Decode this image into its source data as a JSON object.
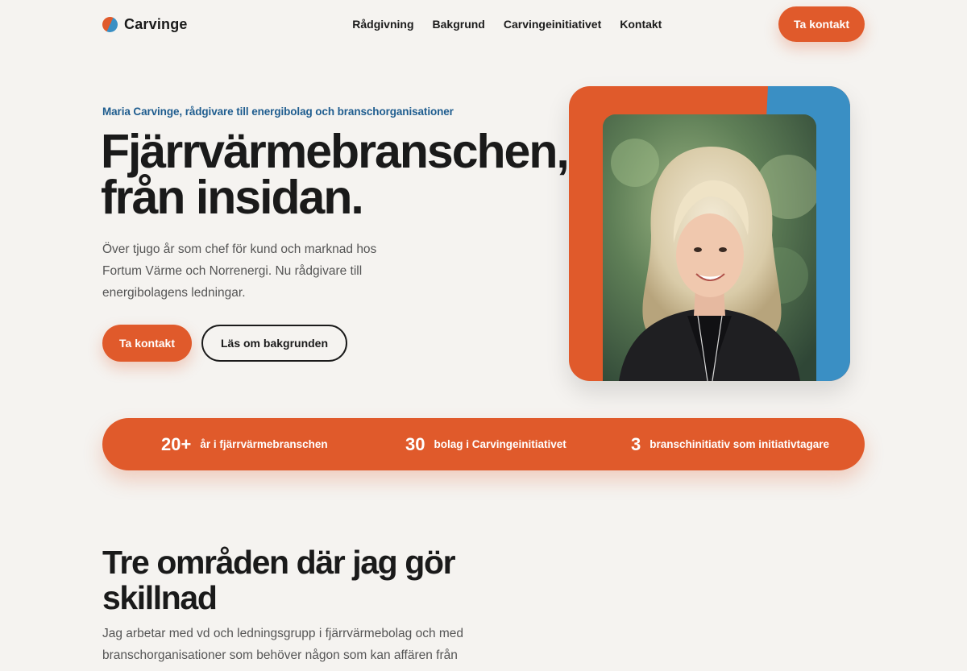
{
  "nav": {
    "brand": "Carvinge",
    "links": [
      "Rådgivning",
      "Bakgrund",
      "Carvingeinitiativet",
      "Kontakt"
    ],
    "cta": "Ta kontakt"
  },
  "hero": {
    "eyebrow": "Maria Carvinge, rådgivare till energibolag och branschorganisationer",
    "title_line1": "Fjärrvärmebranschen,",
    "title_line2": "från insidan.",
    "text": "Över tjugo år som chef för kund och marknad hos Fortum Värme och Norrenergi. Nu rådgivare till energibolagens ledningar.",
    "primary_button": "Ta kontakt",
    "secondary_button": "Läs om bakgrunden"
  },
  "stats": [
    {
      "number": "20+",
      "label": "år i fjärrvärmebranschen"
    },
    {
      "number": "30",
      "label": "bolag i Carvingeinitiativet"
    },
    {
      "number": "3",
      "label": "branschinitiativ som initiativtagare"
    }
  ],
  "section": {
    "title": "Tre områden där jag gör skillnad",
    "text": "Jag arbetar med vd och ledningsgrupp i fjärrvärmebolag och med branschorganisationer som behöver någon som kan affären från insidan."
  },
  "colors": {
    "accent": "#e05a2b",
    "blue": "#3a8fc4",
    "eyebrow": "#1f5d8f",
    "background": "#f5f3f0"
  }
}
